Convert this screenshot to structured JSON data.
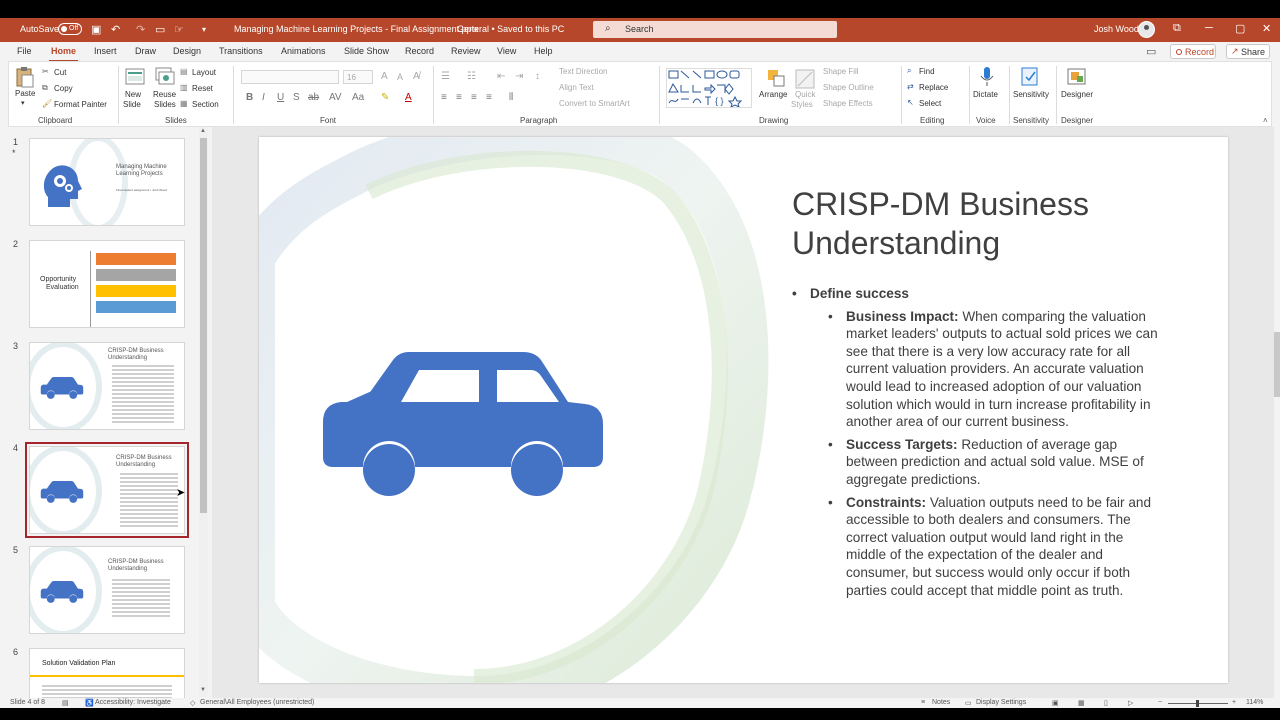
{
  "titlebar": {
    "autosave_label": "AutoSave",
    "autosave_state": "Off",
    "document_title": "Managing Machine Learning Projects - Final Assignment.pptx",
    "sensitivity_status": "General • Saved to this PC",
    "search_placeholder": "Search",
    "user_name": "Josh Wood"
  },
  "menu": {
    "tabs": [
      "File",
      "Home",
      "Insert",
      "Draw",
      "Design",
      "Transitions",
      "Animations",
      "Slide Show",
      "Record",
      "Review",
      "View",
      "Help"
    ],
    "active": "Home",
    "record_label": "Record",
    "share_label": "Share"
  },
  "ribbon": {
    "clipboard": {
      "paste": "Paste",
      "cut": "Cut",
      "copy": "Copy",
      "format_painter": "Format Painter",
      "label": "Clipboard"
    },
    "slides": {
      "new_slide_1": "New",
      "new_slide_2": "Slide",
      "reuse_1": "Reuse",
      "reuse_2": "Slides",
      "layout": "Layout",
      "reset": "Reset",
      "section": "Section",
      "label": "Slides"
    },
    "font": {
      "size": "16",
      "label": "Font"
    },
    "paragraph": {
      "text_direction": "Text Direction",
      "align_text": "Align Text",
      "convert_smartart": "Convert to SmartArt",
      "label": "Paragraph"
    },
    "drawing": {
      "arrange": "Arrange",
      "quick_styles_1": "Quick",
      "quick_styles_2": "Styles",
      "shape_fill": "Shape Fill",
      "shape_outline": "Shape Outline",
      "shape_effects": "Shape Effects",
      "label": "Drawing"
    },
    "editing": {
      "find": "Find",
      "replace": "Replace",
      "select": "Select",
      "label": "Editing"
    },
    "voice": {
      "dictate": "Dictate",
      "label": "Voice"
    },
    "sensitivity": {
      "button": "Sensitivity",
      "label": "Sensitivity"
    },
    "designer": {
      "button": "Designer",
      "label": "Designer"
    }
  },
  "thumbnails": [
    {
      "num": "1",
      "title_1": "Managing Machine",
      "title_2": "Learning Projects",
      "subtitle": "Final student assignment • Josh Wood"
    },
    {
      "num": "2",
      "title_1": "Opportunity",
      "title_2": "Evaluation"
    },
    {
      "num": "3",
      "title_1": "CRISP-DM Business",
      "title_2": "Understanding"
    },
    {
      "num": "4",
      "title_1": "CRISP-DM Business",
      "title_2": "Understanding"
    },
    {
      "num": "5",
      "title_1": "CRISP-DM Business",
      "title_2": "Understanding"
    },
    {
      "num": "6",
      "title_1": "Solution Validation Plan"
    }
  ],
  "slide": {
    "title_line1": "CRISP-DM Business",
    "title_line2": "Understanding",
    "bullet_main": "Define success",
    "bullets": [
      {
        "label": "Business Impact:",
        "text": " When comparing the valuation market leaders' outputs to actual sold prices we can see that there is a very low accuracy rate for all current valuation providers. An accurate valuation would lead to increased adoption of our valuation solution which would in turn increase profitability in another area of our current business."
      },
      {
        "label": "Success Targets:",
        "text": " Reduction of average gap between prediction and actual sold value. MSE of aggregate predictions."
      },
      {
        "label": "Constraints:",
        "text": " Valuation outputs need to be fair and accessible to both dealers and consumers. The correct valuation output would land right in the middle of the expectation of the dealer and consumer, but success would only occur if both parties could accept that middle point as truth."
      }
    ]
  },
  "status": {
    "slide_of": "Slide 4 of 8",
    "accessibility": "Accessibility: Investigate",
    "sensitivity": "General\\All Employees (unrestricted)",
    "notes": "Notes",
    "display_settings": "Display Settings",
    "zoom": "114%"
  },
  "colors": {
    "accent": "#b7472a",
    "car": "#4472c4",
    "selected_outline": "#a4262c"
  }
}
